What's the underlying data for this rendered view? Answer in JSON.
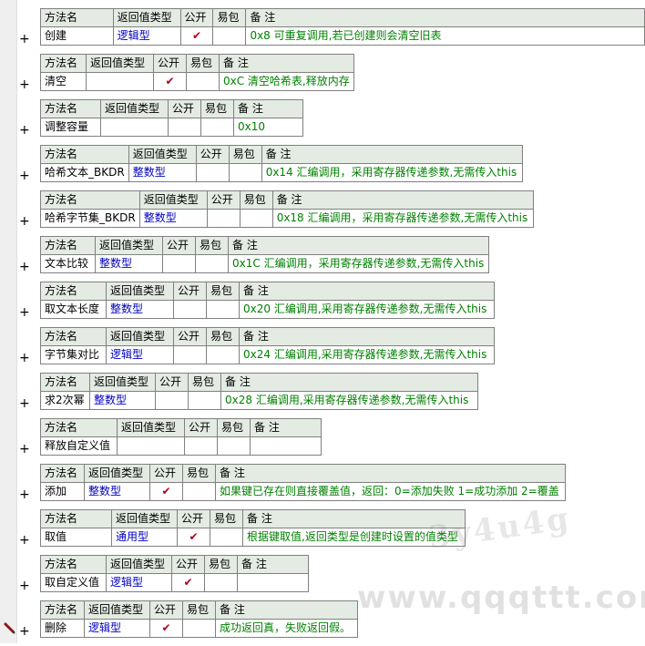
{
  "headers": {
    "method": "方法名",
    "return_type": "返回值类型",
    "public": "公开",
    "easy_pkg": "易包",
    "remark": "备 注"
  },
  "plus_symbol": "+",
  "check_mark": "✔",
  "methods": [
    {
      "name": "创建",
      "return_type": "逻辑型",
      "public": true,
      "remark": "0x8  可重复调用,若已创建则会清空旧表"
    },
    {
      "name": "清空",
      "return_type": "",
      "public": true,
      "remark": "0xC 清空哈希表,释放内存"
    },
    {
      "name": "调整容量",
      "return_type": "",
      "public": false,
      "remark": "0x10"
    },
    {
      "name": "哈希文本_BKDR",
      "return_type": "整数型",
      "public": false,
      "remark": "0x14 汇编调用，采用寄存器传递参数,无需传入this"
    },
    {
      "name": "哈希字节集_BKDR",
      "return_type": "整数型",
      "public": false,
      "remark": "0x18 汇编调用，采用寄存器传递参数,无需传入this"
    },
    {
      "name": "文本比较",
      "return_type": "整数型",
      "public": false,
      "remark": "0x1C 汇编调用，采用寄存器传递参数,无需传入this"
    },
    {
      "name": "取文本长度",
      "return_type": "整数型",
      "public": false,
      "remark": "0x20 汇编调用,采用寄存器传递参数,无需传入this"
    },
    {
      "name": "字节集对比",
      "return_type": "逻辑型",
      "public": false,
      "remark": "0x24 汇编调用,采用寄存器传递参数,无需传入this"
    },
    {
      "name": "求2次幂",
      "return_type": "整数型",
      "public": false,
      "remark": "0x28 汇编调用,采用寄存器传递参数,无需传入this"
    },
    {
      "name": "释放自定义值",
      "return_type": "",
      "public": false,
      "remark": ""
    },
    {
      "name": "添加",
      "return_type": "整数型",
      "public": true,
      "remark": "如果键已存在则直接覆盖值，返回：0=添加失败  1=成功添加  2=覆盖"
    },
    {
      "name": "取值",
      "return_type": "通用型",
      "public": true,
      "remark": "根据键取值,返回类型是创建时设置的值类型"
    },
    {
      "name": "取自定义值",
      "return_type": "逻辑型",
      "public": true,
      "remark": ""
    },
    {
      "name": "删除",
      "return_type": "逻辑型",
      "public": true,
      "remark": "成功返回真，失败返回假。"
    }
  ],
  "watermark": {
    "line1": "3y4u4g",
    "line2": "www.qqqttt.com"
  }
}
